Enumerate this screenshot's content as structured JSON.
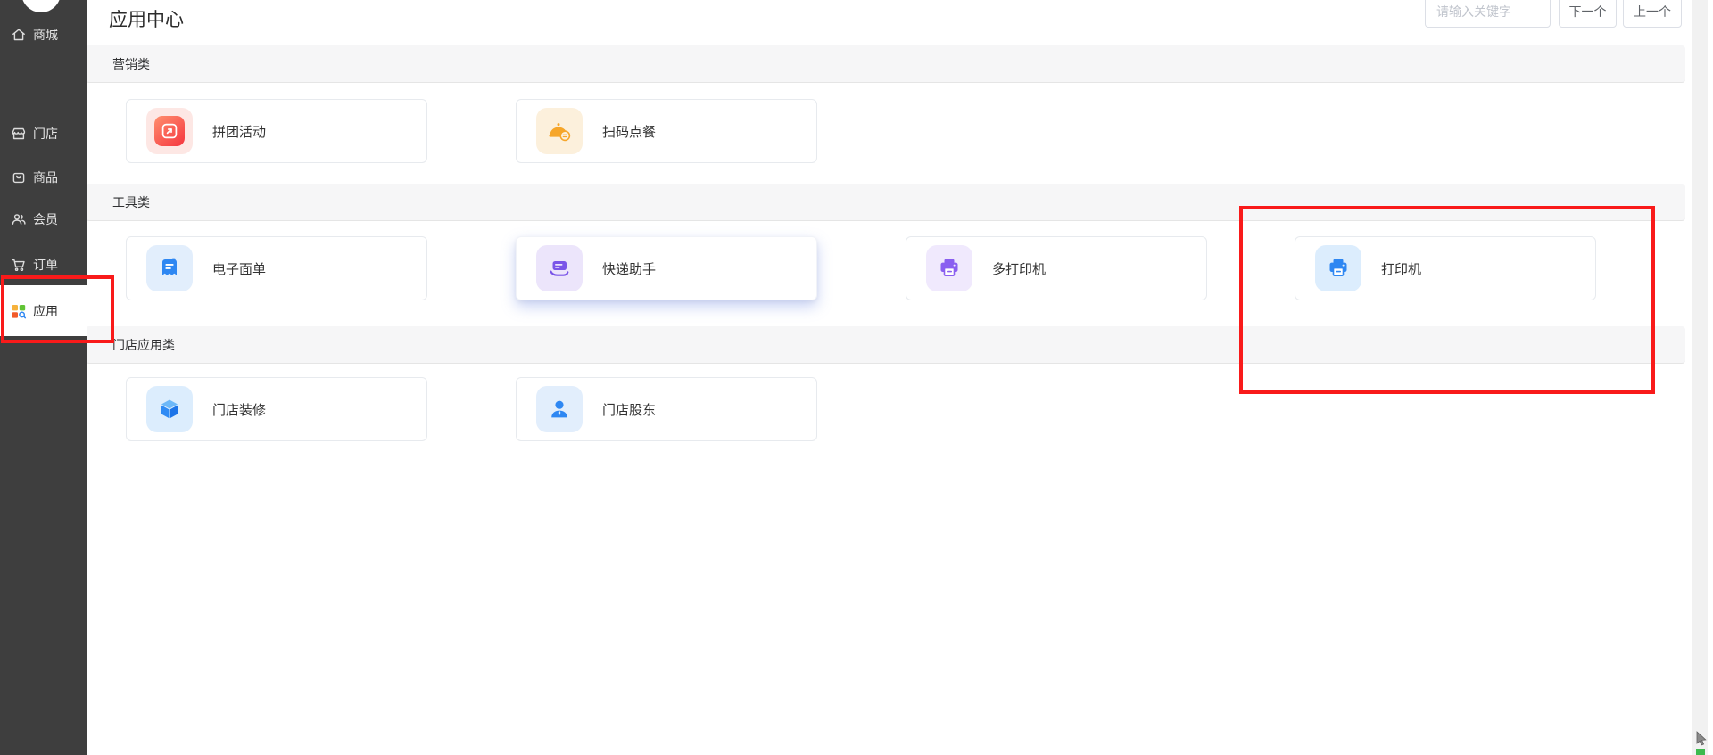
{
  "sidebar": {
    "items": [
      {
        "label": "商城",
        "icon": "home"
      },
      {
        "label": "门店",
        "icon": "storefront"
      },
      {
        "label": "商品",
        "icon": "goods-bag"
      },
      {
        "label": "会员",
        "icon": "members"
      },
      {
        "label": "订单",
        "icon": "order-cart"
      },
      {
        "label": "应用",
        "icon": "apps-grid"
      }
    ],
    "selected": "应用"
  },
  "header": {
    "title": "应用中心"
  },
  "search": {
    "placeholder": "请输入关键字",
    "next_label": "下一个",
    "prev_label": "上一个"
  },
  "sections": [
    {
      "label": "营销类",
      "apps": [
        {
          "label": "拼团活动",
          "icon": "group-buy-icon"
        },
        {
          "label": "扫码点餐",
          "icon": "scan-order-icon"
        }
      ]
    },
    {
      "label": "工具类",
      "apps": [
        {
          "label": "电子面单",
          "icon": "e-waybill-icon"
        },
        {
          "label": "快递助手",
          "icon": "express-helper-icon",
          "state": "hover-elevated"
        },
        {
          "label": "多打印机",
          "icon": "multi-printer-icon"
        },
        {
          "label": "打印机",
          "icon": "printer-icon",
          "state": "annotated"
        }
      ]
    },
    {
      "label": "门店应用类",
      "apps": [
        {
          "label": "门店装修",
          "icon": "store-deco-icon"
        },
        {
          "label": "门店股东",
          "icon": "shareholder-icon"
        }
      ]
    }
  ],
  "annotations": {
    "color": "#f91a1a",
    "targets": [
      "sidebar-apps-item",
      "printer-card-region"
    ]
  },
  "colors": {
    "sidebar_bg": "#3e3e3e",
    "band_bg": "#f6f6f7",
    "accent_blue": "#2e87f2",
    "accent_purple": "#7a55e8",
    "accent_orange": "#f6a62a",
    "accent_red": "#f5353f",
    "annotation_red": "#f91a1a"
  }
}
